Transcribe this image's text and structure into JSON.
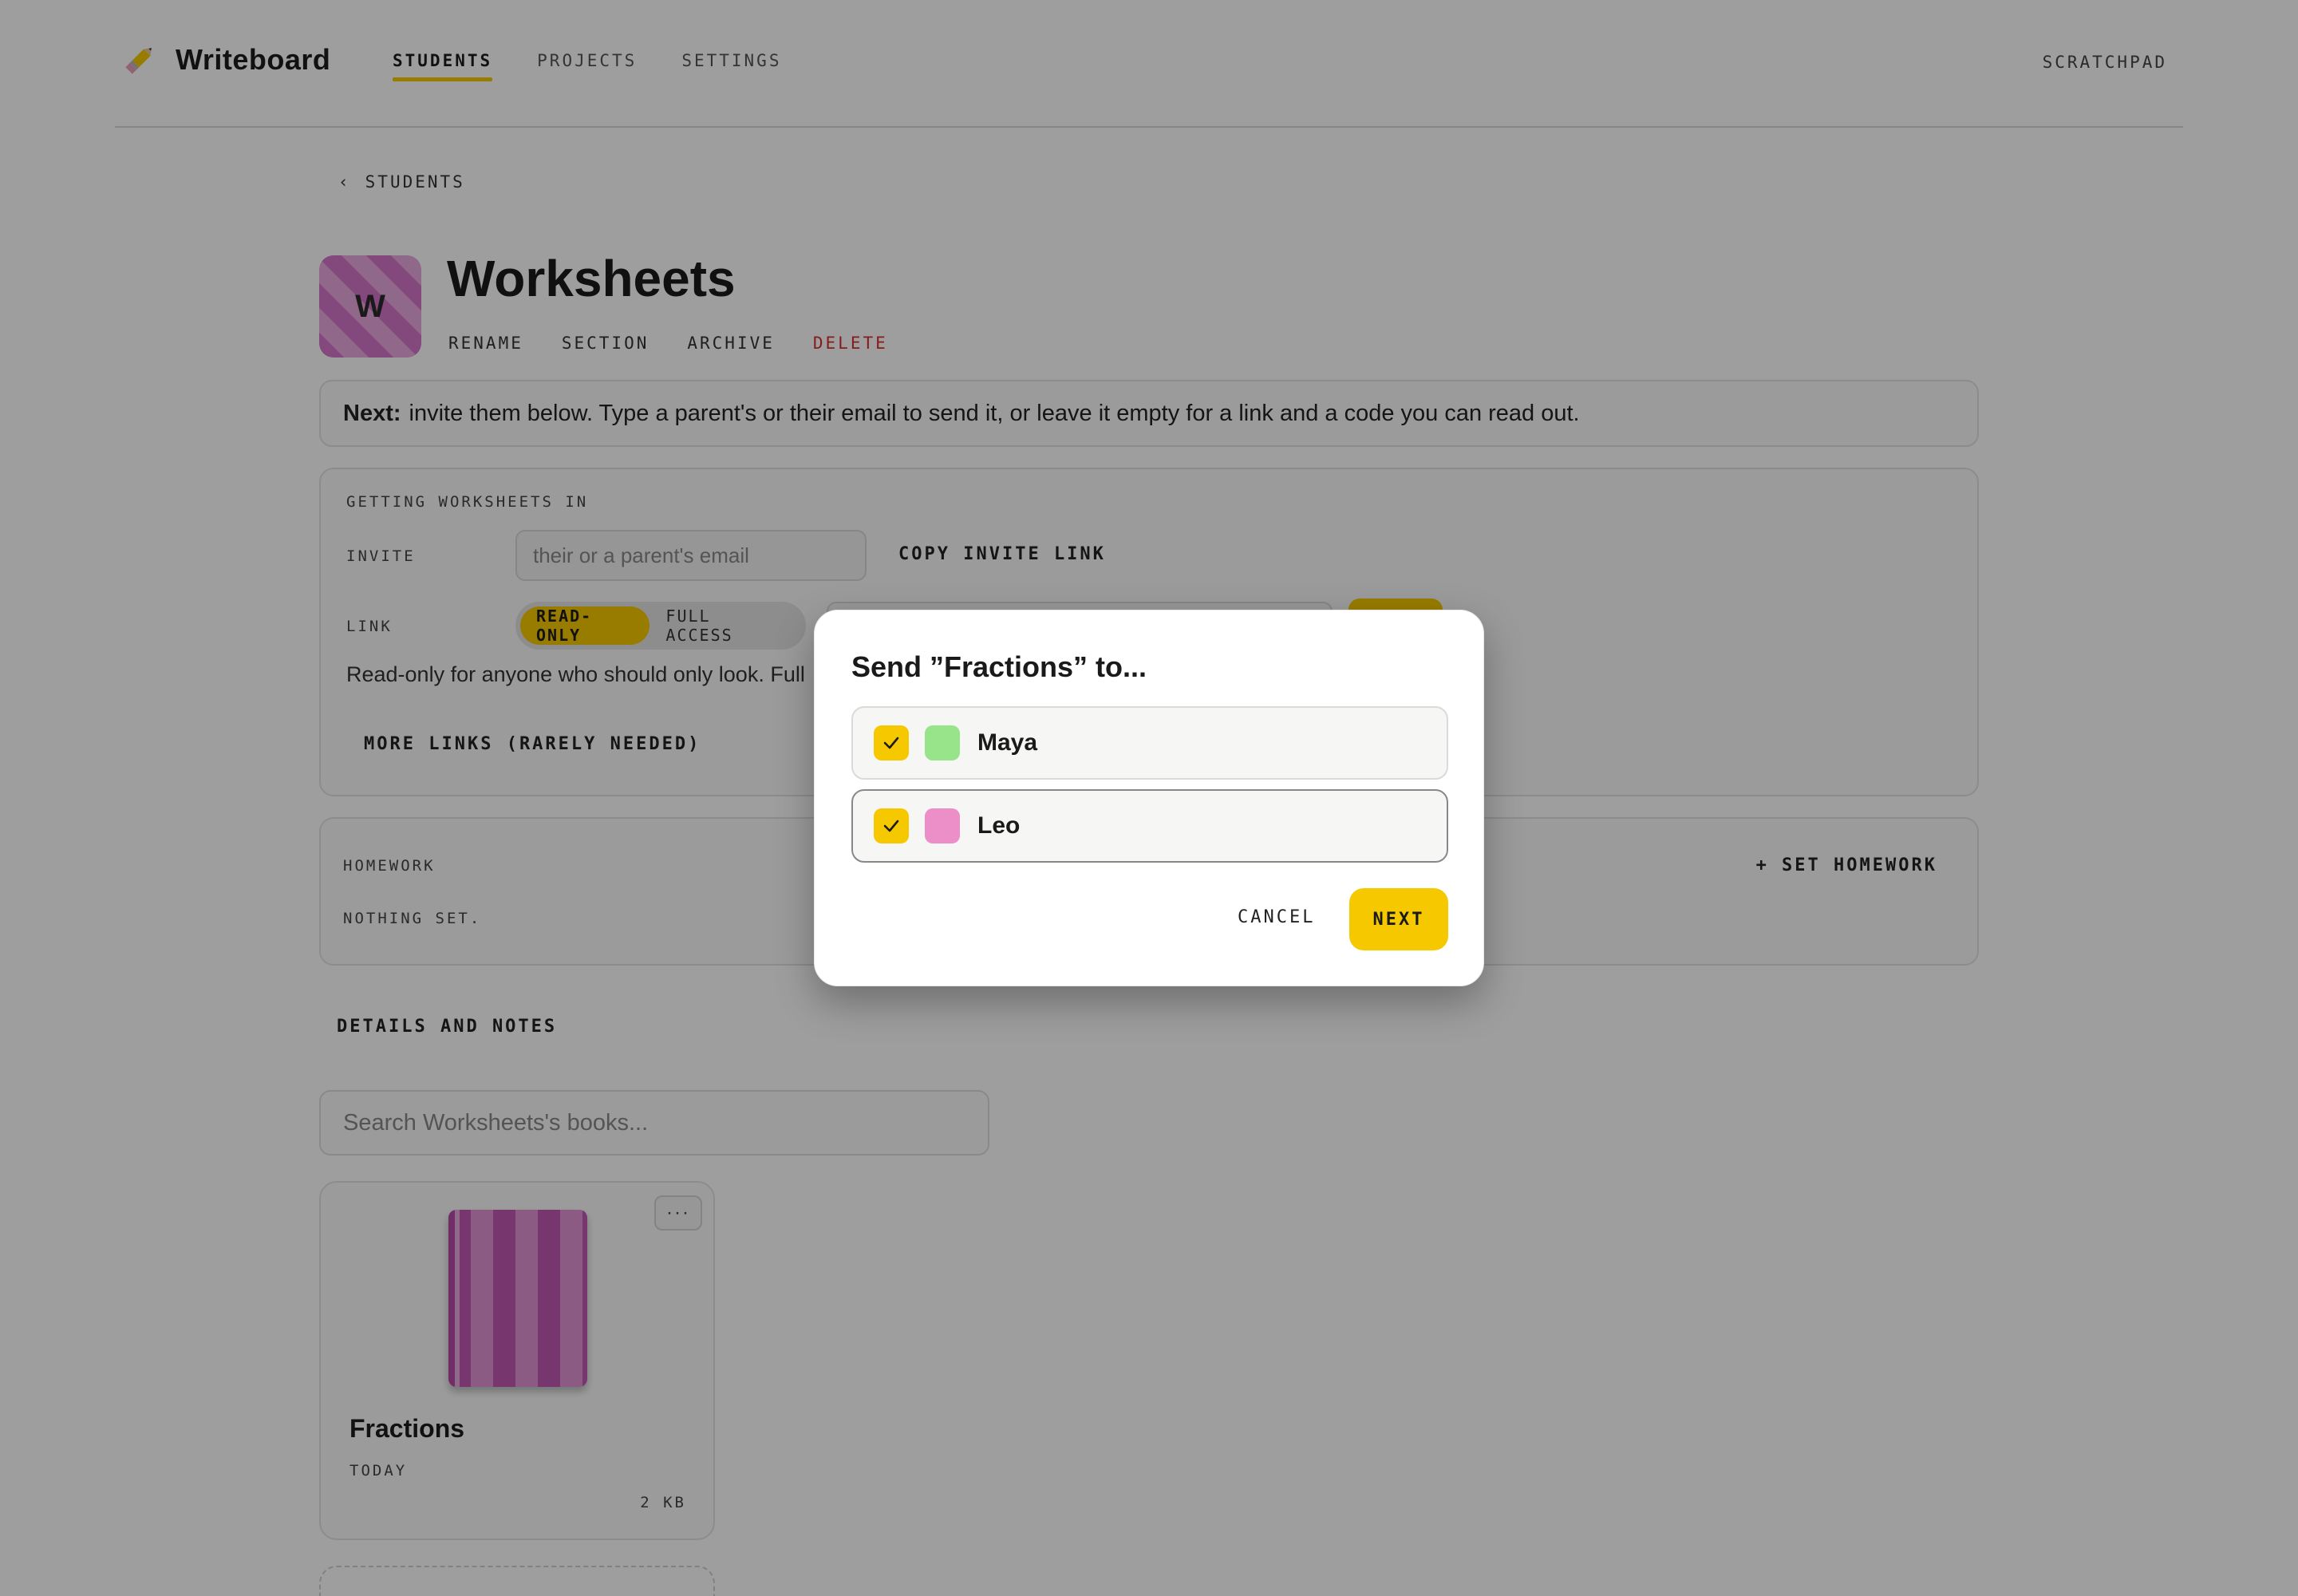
{
  "brand": {
    "name": "Writeboard",
    "icon": "pencil-icon"
  },
  "nav": {
    "students": "STUDENTS",
    "projects": "PROJECTS",
    "settings": "SETTINGS",
    "scratchpad": "SCRATCHPAD"
  },
  "back": {
    "chevron": "‹",
    "label": "STUDENTS"
  },
  "student": {
    "initial": "W",
    "name": "Worksheets",
    "actions": {
      "rename": "RENAME",
      "section": "SECTION",
      "archive": "ARCHIVE",
      "delete": "DELETE"
    }
  },
  "banner": {
    "bold": "Next:",
    "text": "invite them below. Type a parent's or their email to send it, or leave it empty for a link and a code you can read out."
  },
  "invite_panel": {
    "heading": "GETTING WORKSHEETS IN",
    "invite_label": "INVITE",
    "email_placeholder": "their or a parent's email",
    "copy_link": "COPY INVITE LINK",
    "link_label": "LINK",
    "read_only": "READ-ONLY",
    "full_access": "FULL ACCESS",
    "help_text": "Read-only for anyone who should only look. Full",
    "more_links": "MORE LINKS (RARELY NEEDED)"
  },
  "homework": {
    "label": "HOMEWORK",
    "empty": "NOTHING SET.",
    "set_button": "+ SET HOMEWORK"
  },
  "details": {
    "label": "DETAILS AND NOTES"
  },
  "books": {
    "search_placeholder": "Search Worksheets's books...",
    "items": [
      {
        "title": "Fractions",
        "date": "TODAY",
        "size": "2 KB",
        "menu": "···"
      }
    ]
  },
  "modal": {
    "title": "Send ”Fractions” to...",
    "recipients": [
      {
        "name": "Maya",
        "color": "#98e48a",
        "checked": true
      },
      {
        "name": "Leo",
        "color": "#ec8fc9",
        "checked": true
      }
    ],
    "cancel": "CANCEL",
    "next": "NEXT"
  },
  "colors": {
    "accent": "#f5c800",
    "danger": "#d93030"
  }
}
